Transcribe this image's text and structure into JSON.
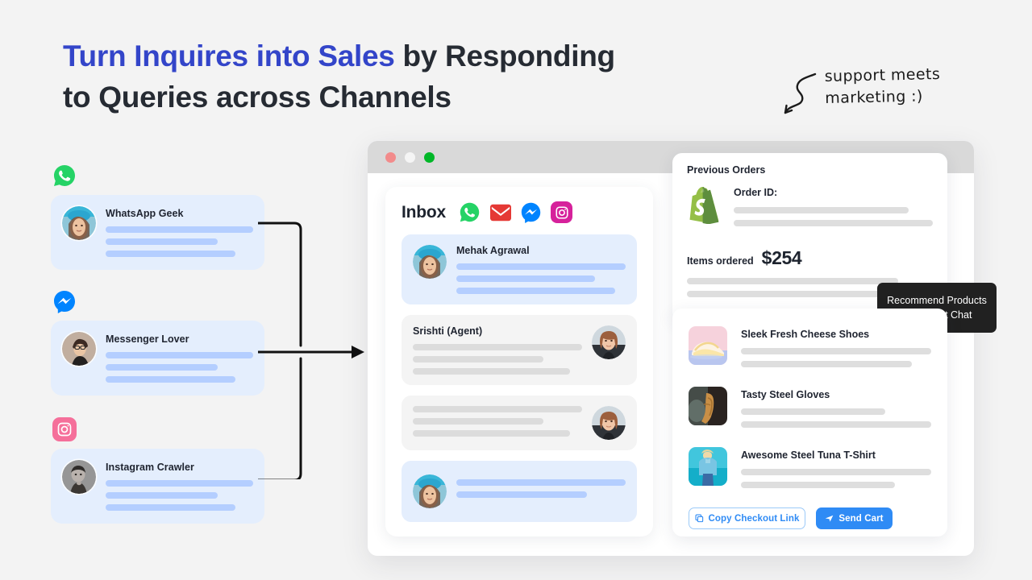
{
  "headline": {
    "accent": "Turn Inquires into Sales",
    "rest": " by Responding",
    "line2": "to Queries across Channels",
    "accent_color": "#3345c9"
  },
  "annotation": {
    "line1": "support meets",
    "line2": "marketing :)"
  },
  "channels": [
    {
      "icon": "whatsapp-icon",
      "name": "WhatsApp Geek",
      "bars": [
        100,
        76,
        88
      ]
    },
    {
      "icon": "messenger-icon",
      "name": "Messenger Lover",
      "bars": [
        100,
        76,
        88
      ]
    },
    {
      "icon": "instagram-icon",
      "name": "Instagram Crawler",
      "bars": [
        100,
        76,
        88
      ]
    }
  ],
  "browser": {
    "dots": [
      "red",
      "white",
      "green"
    ]
  },
  "inbox": {
    "title": "Inbox",
    "channel_icons": [
      "whatsapp-icon",
      "gmail-icon",
      "messenger-icon",
      "instagram-icon"
    ],
    "messages": [
      {
        "type": "customer",
        "name": "Mehak Agrawal",
        "bars": [
          100,
          82,
          94
        ]
      },
      {
        "type": "agent",
        "name": "Srishti (Agent)",
        "bars": [
          100,
          77,
          93
        ]
      },
      {
        "type": "agent",
        "name": "",
        "bars": [
          100,
          77,
          93
        ]
      },
      {
        "type": "customer",
        "name": "",
        "bars": [
          100,
          77
        ]
      }
    ]
  },
  "orders": {
    "card_title": "Previous Orders",
    "logo": "shopify-icon",
    "order_id_label": "Order ID:",
    "order_id_bars": [
      88,
      100
    ],
    "items_label": "Items ordered",
    "items_amount": "$254",
    "items_bars": [
      86,
      96
    ]
  },
  "tooltip": {
    "line1": "Recommend Products",
    "line2": "in Support Chat"
  },
  "products": {
    "items": [
      {
        "name": "Sleek Fresh Cheese Shoes",
        "thumb": "shoes-thumb",
        "bars": [
          100,
          90
        ]
      },
      {
        "name": "Tasty Steel Gloves",
        "thumb": "gloves-thumb",
        "bars": [
          76,
          100
        ]
      },
      {
        "name": "Awesome Steel Tuna T-Shirt",
        "thumb": "tshirt-thumb",
        "bars": [
          100,
          81
        ]
      }
    ],
    "copy_button": "Copy Checkout Link",
    "copy_icon": "copy-icon",
    "send_button": "Send Cart",
    "send_icon": "send-icon",
    "accent_color": "#2f8bf5"
  }
}
